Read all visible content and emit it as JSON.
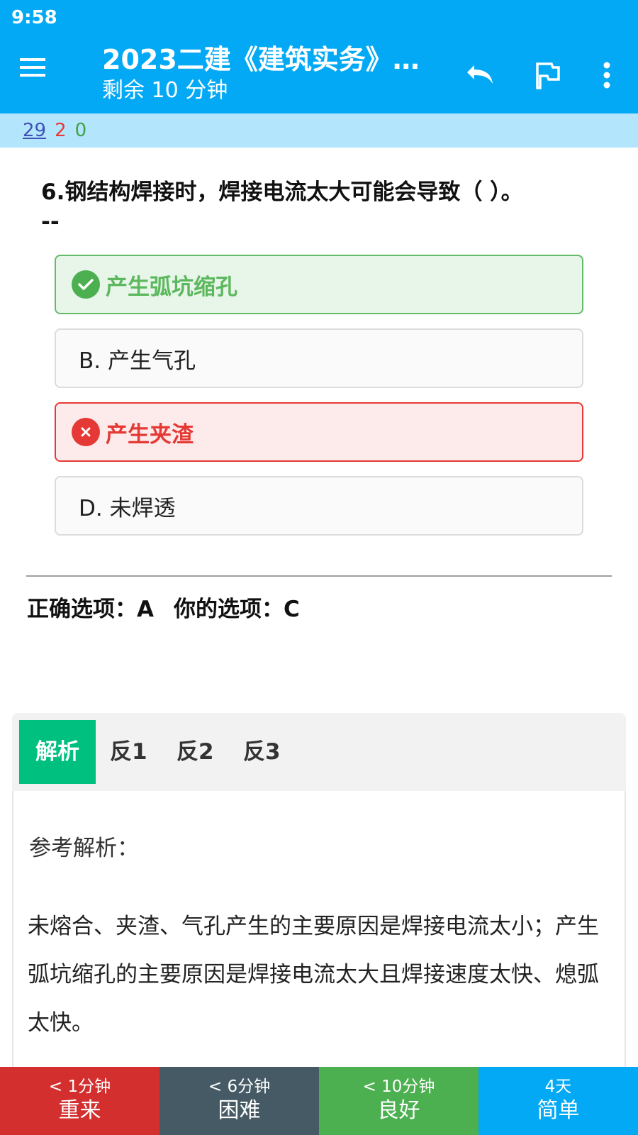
{
  "status_bar": {
    "time": "9:58"
  },
  "app_bar": {
    "title": "2023二建《建筑实务》…",
    "subtitle": "剩余 10 分钟",
    "icons": {
      "menu": "menu-icon",
      "undo": "undo-icon",
      "flag": "flag-icon",
      "more": "more-vert-icon"
    },
    "color": "#03a9f4"
  },
  "counters": {
    "total": "29",
    "wrong": "2",
    "correct": "0"
  },
  "question": {
    "text": "6.钢结构焊接时，焊接电流太大可能会导致（ ）。",
    "suffix": "--",
    "options": [
      {
        "label": "产生弧坑缩孔",
        "state": "correct",
        "icon": "check-circle-icon"
      },
      {
        "label": "B. 产生气孔",
        "state": "normal"
      },
      {
        "label": "产生夹渣",
        "state": "wrong",
        "icon": "close-circle-icon"
      },
      {
        "label": "D. 未焊透",
        "state": "normal"
      }
    ]
  },
  "answer": {
    "correct_text": "正确选项：A",
    "yours_text": "你的选项：C"
  },
  "tabs": [
    {
      "label": "解析",
      "active": true
    },
    {
      "label": "反1",
      "active": false
    },
    {
      "label": "反2",
      "active": false
    },
    {
      "label": "反3",
      "active": false
    }
  ],
  "explanation": {
    "heading": "参考解析：",
    "body": "未熔合、夹渣、气孔产生的主要原因是焊接电流太小；产生弧坑缩孔的主要原因是焊接电流太大且焊接速度太快、熄弧太快。"
  },
  "rating": [
    {
      "interval": "< 1分钟",
      "label": "重来",
      "color": "#d32f2f"
    },
    {
      "interval": "< 6分钟",
      "label": "困难",
      "color": "#455a64"
    },
    {
      "interval": "< 10分钟",
      "label": "良好",
      "color": "#4caf50"
    },
    {
      "interval": "4天",
      "label": "简单",
      "color": "#03a9f4"
    }
  ]
}
